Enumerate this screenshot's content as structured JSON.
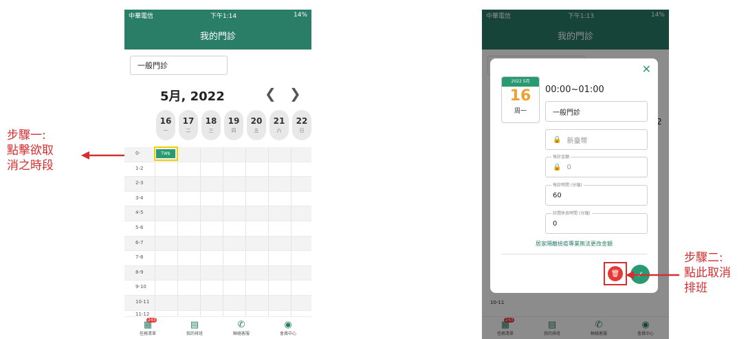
{
  "step1": {
    "lines": [
      "步驟一:",
      "點擊欲取",
      "消之時段"
    ]
  },
  "step2": {
    "lines": [
      "步驟二:",
      "點此取消",
      "排班"
    ]
  },
  "phone1": {
    "status": {
      "carrier": "中華電信",
      "time": "下午1:14",
      "battery": "14%"
    },
    "title": "我的門診",
    "select_value": "一般門診",
    "month": "5月, 2022",
    "days": [
      {
        "num": "16",
        "wk": "一"
      },
      {
        "num": "17",
        "wk": "二"
      },
      {
        "num": "18",
        "wk": "三"
      },
      {
        "num": "19",
        "wk": "四"
      },
      {
        "num": "20",
        "wk": "五"
      },
      {
        "num": "21",
        "wk": "六"
      },
      {
        "num": "22",
        "wk": "日"
      }
    ],
    "times": [
      "0-",
      "1-2",
      "2-3",
      "3-4",
      "4-5",
      "5-6",
      "6-7",
      "7-8",
      "8-9",
      "9-10",
      "10-11",
      "11-12"
    ],
    "slot_tag": "TW$",
    "nav": [
      {
        "label": "任務清單",
        "badge": "243",
        "icon": "task-list-icon"
      },
      {
        "label": "我的排班",
        "icon": "calendar-icon"
      },
      {
        "label": "聯絡客服",
        "icon": "phone-icon"
      },
      {
        "label": "會員中心",
        "icon": "user-icon"
      }
    ]
  },
  "phone2": {
    "status": {
      "carrier": "中華電信",
      "time": "下午1:13",
      "battery": "14%"
    },
    "title": "我的門診",
    "bg_time": "10-11",
    "bg_num": "2",
    "modal": {
      "cal_month": "2022 5月",
      "cal_day": "16",
      "cal_weekday": "周一",
      "time_range": "00:00~01:00",
      "clinic_type": "一般門診",
      "currency": "新臺幣",
      "fee_label": "每診金額",
      "fee_value": "0",
      "duration_label": "每診時間 (分鐘)",
      "duration_value": "60",
      "break_label": "診間休息時間 (分鐘)",
      "break_value": "0",
      "note": "居家隔離檢疫專業無法更改金額"
    },
    "nav": [
      {
        "label": "任務清單",
        "badge": "243"
      },
      {
        "label": "我的排班"
      },
      {
        "label": "聯絡客服"
      },
      {
        "label": "會員中心"
      }
    ]
  },
  "colors": {
    "primary": "#2a7d67",
    "accent": "#2a9a73",
    "annotation": "#d32f2f",
    "highlight": "#f0d000"
  }
}
